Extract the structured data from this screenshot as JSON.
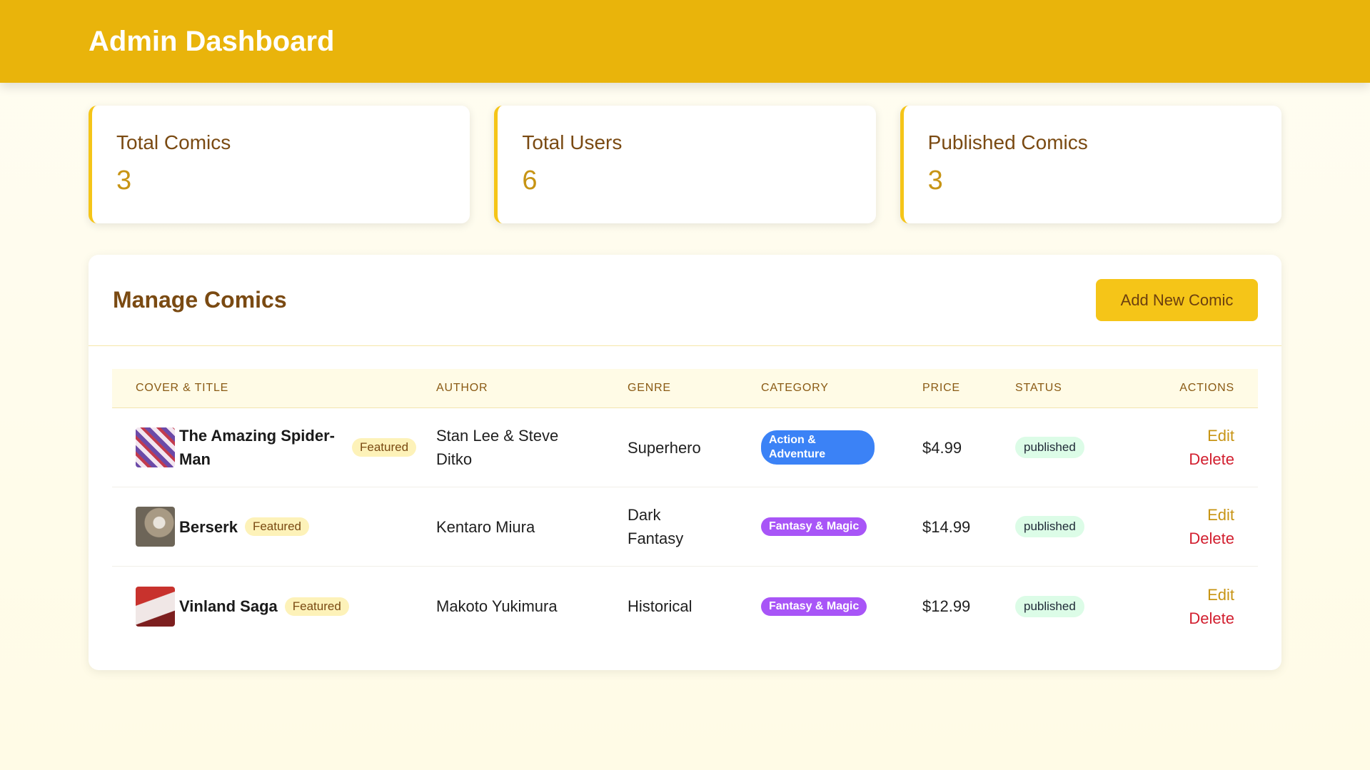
{
  "header": {
    "title": "Admin Dashboard"
  },
  "stats": [
    {
      "label": "Total Comics",
      "value": "3"
    },
    {
      "label": "Total Users",
      "value": "6"
    },
    {
      "label": "Published Comics",
      "value": "3"
    }
  ],
  "panel": {
    "title": "Manage Comics",
    "add_button": "Add New Comic"
  },
  "table": {
    "columns": [
      "COVER & TITLE",
      "AUTHOR",
      "GENRE",
      "CATEGORY",
      "PRICE",
      "STATUS",
      "ACTIONS"
    ],
    "rows": [
      {
        "title": "The Amazing Spider-Man",
        "featured": "Featured",
        "author": "Stan Lee & Steve Ditko",
        "genre": "Superhero",
        "category": "Action & Adventure",
        "price": "$4.99",
        "status": "published",
        "edit": "Edit",
        "delete": "Delete"
      },
      {
        "title": "Berserk",
        "featured": "Featured",
        "author": "Kentaro Miura",
        "genre": "Dark Fantasy",
        "category": "Fantasy & Magic",
        "price": "$14.99",
        "status": "published",
        "edit": "Edit",
        "delete": "Delete"
      },
      {
        "title": "Vinland Saga",
        "featured": "Featured",
        "author": "Makoto Yukimura",
        "genre": "Historical",
        "category": "Fantasy & Magic",
        "price": "$12.99",
        "status": "published",
        "edit": "Edit",
        "delete": "Delete"
      }
    ]
  },
  "colors": {
    "header": "#e9b40b",
    "accent": "#f5c518",
    "category_blue": "#3b82f6",
    "category_purple": "#a855f7",
    "delete": "#d21f2f"
  }
}
